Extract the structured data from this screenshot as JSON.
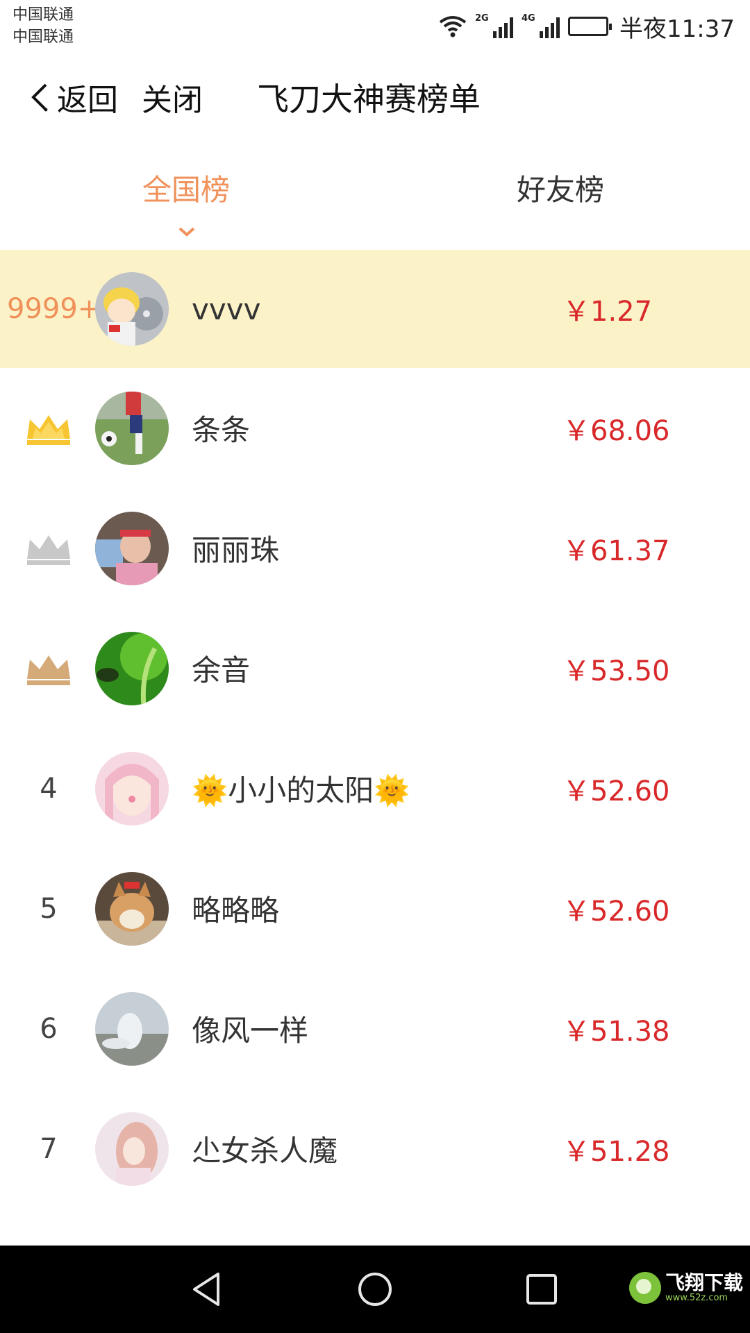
{
  "status_bar": {
    "carrier_1": "中国联通",
    "carrier_2": "中国联通",
    "net_1": "2G",
    "net_2": "4G",
    "time": "半夜11:37"
  },
  "header": {
    "back_label": "返回",
    "close_label": "关闭",
    "title": "飞刀大神赛榜单"
  },
  "tabs": [
    {
      "label": "全国榜",
      "active": true
    },
    {
      "label": "好友榜",
      "active": false
    }
  ],
  "colors": {
    "accent": "#f0915a",
    "amount": "#d9282a",
    "highlight_row": "#fbf2c8",
    "crown_gold": "#f7c531",
    "crown_silver": "#c8c8c8",
    "crown_bronze": "#d4aa78"
  },
  "me": {
    "rank": "9999+",
    "name": "vvvv",
    "amount": "￥1.27"
  },
  "ranking": [
    {
      "rank": "",
      "icon": "crown-gold-icon",
      "name": "条条",
      "amount": "￥68.06"
    },
    {
      "rank": "",
      "icon": "crown-silver-icon",
      "name": "丽丽珠",
      "amount": "￥61.37"
    },
    {
      "rank": "",
      "icon": "crown-bronze-icon",
      "name": "余音",
      "amount": "￥53.50"
    },
    {
      "rank": "4",
      "name": "🌞小小的太阳🌞",
      "amount": "￥52.60"
    },
    {
      "rank": "5",
      "name": "略略略",
      "amount": "￥52.60"
    },
    {
      "rank": "6",
      "name": "像风一样",
      "amount": "￥51.38"
    },
    {
      "rank": "7",
      "name": "尐女杀人魔",
      "amount": "￥51.28"
    }
  ],
  "watermark": {
    "main": "飞翔下载",
    "sub": "www.52z.com"
  }
}
